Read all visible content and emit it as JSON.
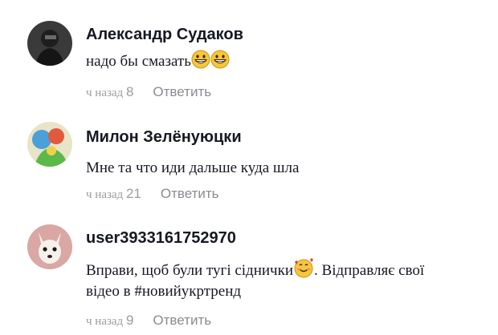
{
  "comments": [
    {
      "author": "Александр Судаков",
      "text": "надо бы смазать",
      "emoji": [
        "grinning-face-with-teeth",
        "grinning-face-with-teeth"
      ],
      "time_prefix": "ч назад",
      "time_num": "8",
      "reply_label": "Ответить"
    },
    {
      "author": "Милон Зелёнуюцки",
      "text": "Мне та что иди дальше куда шла",
      "time_prefix": "ч назад",
      "time_num": "21",
      "reply_label": "Ответить"
    },
    {
      "author": "user3933161752970",
      "text_part1": "Вправи, щоб були тугі сіднички",
      "emoji": [
        "smiling-face-with-hearts"
      ],
      "text_part2": ". Відправляє свої",
      "text_line2": "відео в #новийукртренд",
      "time_prefix": "ч назад",
      "time_num": "9",
      "reply_label": "Ответить"
    }
  ]
}
